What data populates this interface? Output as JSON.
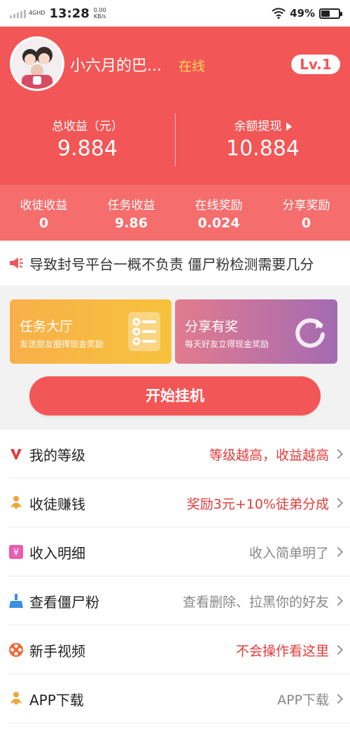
{
  "status_bar": {
    "network": "4GHD",
    "time": "13:28",
    "speed_value": "0.00",
    "speed_unit": "KB/s",
    "battery_percent": "49%",
    "battery_level": 0.49
  },
  "profile": {
    "username": "小六月的巴...",
    "status": "在线",
    "level": "Lv.1"
  },
  "earnings": {
    "total_label": "总收益（元）",
    "total_value": "9.884",
    "balance_label": "余额提现",
    "balance_value": "10.884"
  },
  "sub_stats": [
    {
      "label": "收徒收益",
      "value": "0"
    },
    {
      "label": "任务收益",
      "value": "9.86"
    },
    {
      "label": "在线奖励",
      "value": "0.024"
    },
    {
      "label": "分享奖励",
      "value": "0"
    }
  ],
  "notice": {
    "text": "导致封号平台一概不负责 僵尸粉检测需要几分"
  },
  "cards": [
    {
      "title": "任务大厅",
      "subtitle": "发送朋友圈得现金奖励"
    },
    {
      "title": "分享有奖",
      "subtitle": "每天好友立得现金奖励"
    }
  ],
  "start_button": "开始挂机",
  "menu": [
    {
      "icon": "v-level-icon",
      "label": "我的等级",
      "right": "等级越高，收益越高"
    },
    {
      "icon": "people-icon",
      "label": "收徒赚钱",
      "right": "奖励3元+10%徒弟分成"
    },
    {
      "icon": "income-detail-icon",
      "label": "收入明细",
      "right": "收入简单明了"
    },
    {
      "icon": "broom-icon",
      "label": "查看僵尸粉",
      "right": "查看删除、拉黑你的好友"
    },
    {
      "icon": "film-reel-icon",
      "label": "新手视频",
      "right": "不会操作看这里"
    },
    {
      "icon": "download-people-icon",
      "label": "APP下载",
      "right": "APP下载"
    }
  ],
  "colors": {
    "primary": "#f35656",
    "accent_text": "#e23c3c",
    "online": "#f6d35a"
  }
}
